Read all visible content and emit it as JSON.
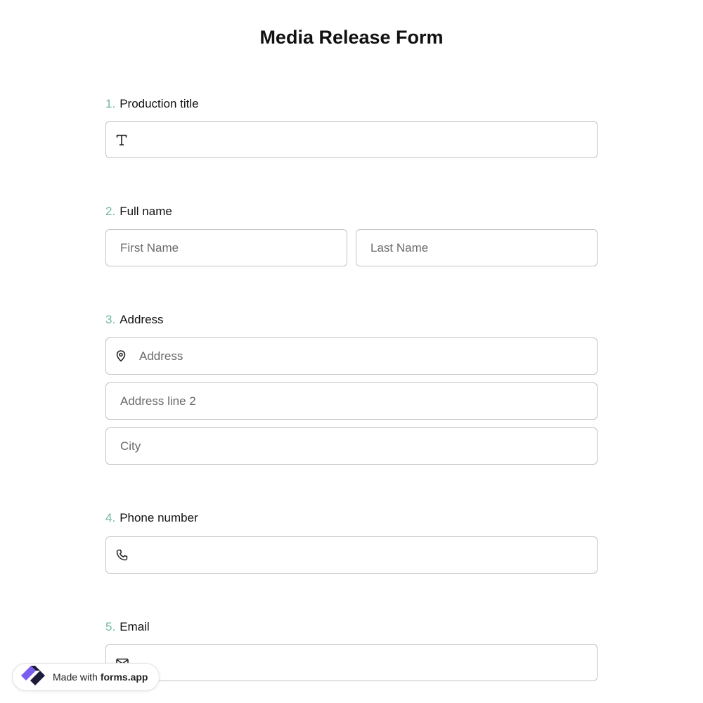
{
  "form": {
    "title": "Media Release Form"
  },
  "questions": [
    {
      "number": "1.",
      "label": "Production title"
    },
    {
      "number": "2.",
      "label": "Full name"
    },
    {
      "number": "3.",
      "label": "Address"
    },
    {
      "number": "4.",
      "label": "Phone number"
    },
    {
      "number": "5.",
      "label": "Email"
    }
  ],
  "fields": {
    "production_title": {
      "placeholder": "",
      "icon": "text-icon"
    },
    "first_name": {
      "placeholder": "First Name"
    },
    "last_name": {
      "placeholder": "Last Name"
    },
    "address": {
      "placeholder": "Address",
      "icon": "location-pin-icon"
    },
    "address_line_2": {
      "placeholder": "Address line 2"
    },
    "city": {
      "placeholder": "City"
    },
    "phone": {
      "placeholder": "",
      "icon": "phone-icon"
    },
    "email": {
      "placeholder": "",
      "icon": "mail-icon"
    }
  },
  "badge": {
    "prefix": "Made with",
    "brand": "forms.app",
    "icon": "forms-app-logo-icon"
  },
  "colors": {
    "number_accent": "#6fb8a6",
    "border": "#c4c4c4",
    "logo_purple": "#7b5cf0",
    "logo_dark": "#1d1b3a"
  }
}
